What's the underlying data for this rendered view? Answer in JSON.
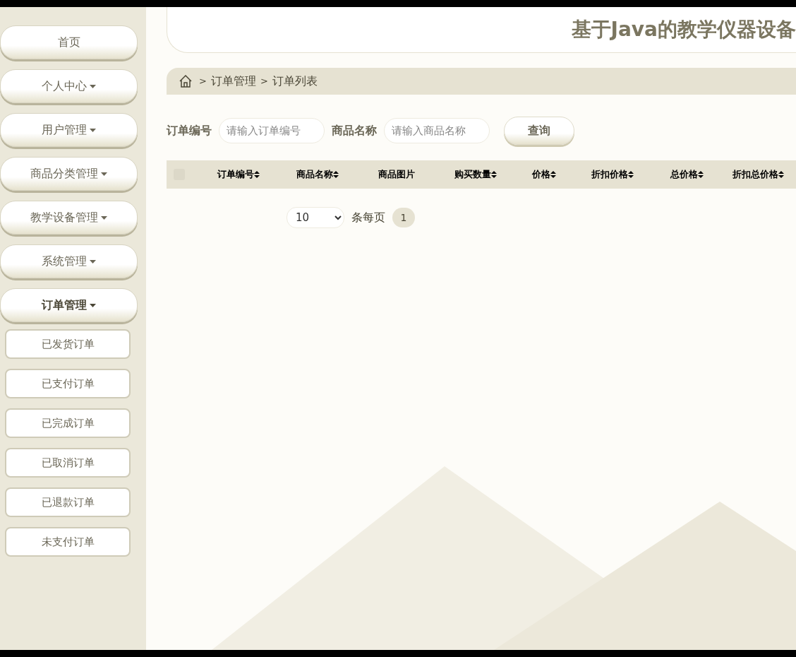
{
  "sidebar": {
    "items": [
      {
        "label": "首页",
        "has_dropdown": false,
        "expanded": false
      },
      {
        "label": "个人中心",
        "has_dropdown": true,
        "expanded": false
      },
      {
        "label": "用户管理",
        "has_dropdown": true,
        "expanded": false
      },
      {
        "label": "商品分类管理",
        "has_dropdown": true,
        "expanded": false
      },
      {
        "label": "教学设备管理",
        "has_dropdown": true,
        "expanded": false
      },
      {
        "label": "系统管理",
        "has_dropdown": true,
        "expanded": false
      },
      {
        "label": "订单管理",
        "has_dropdown": true,
        "expanded": true,
        "children": [
          {
            "label": "已发货订单"
          },
          {
            "label": "已支付订单"
          },
          {
            "label": "已完成订单"
          },
          {
            "label": "已取消订单"
          },
          {
            "label": "已退款订单"
          },
          {
            "label": "未支付订单"
          }
        ]
      }
    ]
  },
  "header": {
    "title": "基于Java的教学仪器设备"
  },
  "breadcrumb": [
    {
      "separator": ">",
      "label": "订单管理"
    },
    {
      "separator": ">",
      "label": "订单列表"
    }
  ],
  "search": {
    "fields": [
      {
        "label": "订单编号",
        "placeholder": "请输入订单编号"
      },
      {
        "label": "商品名称",
        "placeholder": "请输入商品名称"
      }
    ],
    "button": "查询"
  },
  "table": {
    "select_all_checked": false,
    "columns": [
      {
        "label": "订单编号",
        "sortable": true
      },
      {
        "label": "商品名称",
        "sortable": true
      },
      {
        "label": "商品图片",
        "sortable": false
      },
      {
        "label": "购买数量",
        "sortable": true
      },
      {
        "label": "价格",
        "sortable": true
      },
      {
        "label": "折扣价格",
        "sortable": true
      },
      {
        "label": "总价格",
        "sortable": true
      },
      {
        "label": "折扣总价格",
        "sortable": true
      }
    ]
  },
  "pagination": {
    "page_size": "10",
    "page_size_label": "条每页",
    "pages": [
      {
        "label": "1",
        "selected": true
      }
    ]
  }
}
